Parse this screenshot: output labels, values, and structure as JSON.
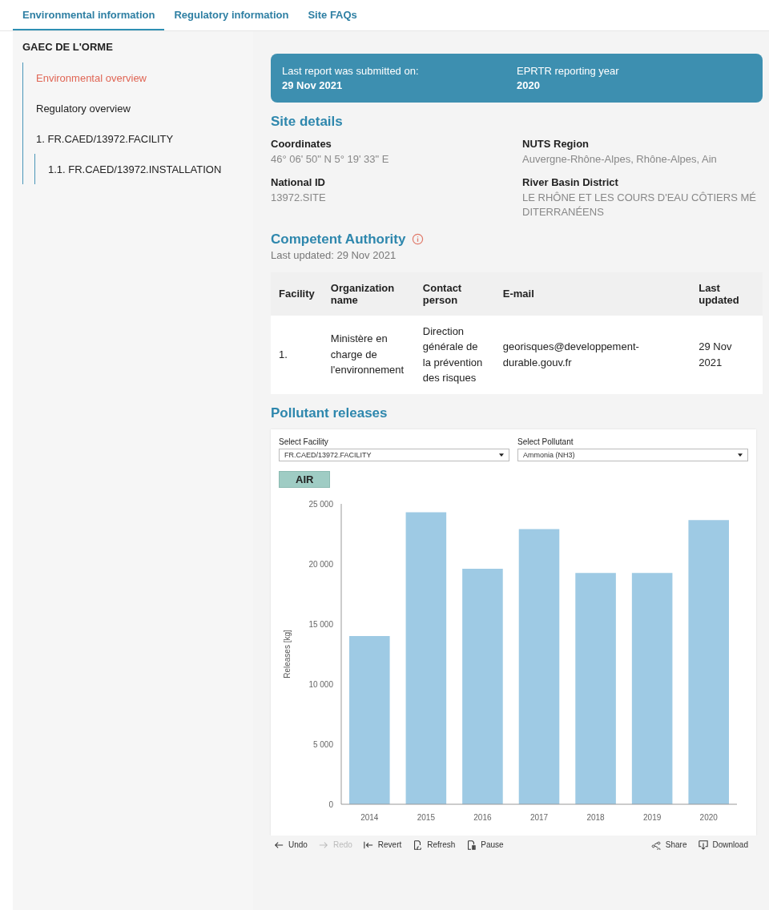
{
  "tabs": [
    {
      "label": "Environmental information",
      "selected": true
    },
    {
      "label": "Regulatory information",
      "selected": false
    },
    {
      "label": "Site FAQs",
      "selected": false
    }
  ],
  "sidebar": {
    "title": "GAEC DE L'ORME",
    "items": [
      {
        "label": "Environmental overview",
        "selected": true
      },
      {
        "label": "Regulatory overview",
        "selected": false
      },
      {
        "label": "1. FR.CAED/13972.FACILITY",
        "selected": false,
        "children": [
          {
            "label": "1.1. FR.CAED/13972.INSTALLATION",
            "selected": false
          }
        ]
      }
    ]
  },
  "banner": [
    {
      "label": "Last report was submitted on:",
      "value": "29 Nov 2021"
    },
    {
      "label": "EPRTR reporting year",
      "value": "2020"
    }
  ],
  "site_details": {
    "title": "Site details",
    "fields": [
      {
        "label": "Coordinates",
        "value": "46° 06' 50\" N 5° 19' 33\" E"
      },
      {
        "label": "NUTS Region",
        "value": "Auvergne-Rhône-Alpes, Rhône-Alpes, Ain"
      },
      {
        "label": "National ID",
        "value": "13972.SITE"
      },
      {
        "label": "River Basin District",
        "value": "LE RHÔNE ET LES COURS D'EAU CÔTIERS MÉDITERRANÉENS"
      }
    ]
  },
  "competent_authority": {
    "title": "Competent Authority",
    "updated": "Last updated: 29 Nov 2021",
    "columns": [
      "Facility",
      "Organization name",
      "Contact person",
      "E-mail",
      "Last updated"
    ],
    "rows": [
      [
        "1.",
        "Ministère en charge de l'environnement",
        "Direction générale de la prévention des risques",
        "georisques@developpement-durable.gouv.fr",
        "29 Nov 2021"
      ]
    ]
  },
  "pollutant_releases": {
    "title": "Pollutant releases",
    "filters": [
      {
        "label": "Select Facility",
        "value": "FR.CAED/13972.FACILITY"
      },
      {
        "label": "Select Pollutant",
        "value": "Ammonia (NH3)"
      }
    ],
    "chart_data": {
      "type": "bar",
      "title": "AIR",
      "ylabel": "Releases [kg]",
      "categories": [
        "2014",
        "2015",
        "2016",
        "2017",
        "2018",
        "2019",
        "2020"
      ],
      "values": [
        14000,
        24300,
        19600,
        22900,
        19250,
        19250,
        23650
      ],
      "ylim": [
        0,
        25000
      ],
      "yticks": [
        {
          "value": 0,
          "label": "0"
        },
        {
          "value": 5000,
          "label": "5 000"
        },
        {
          "value": 10000,
          "label": "10 000"
        },
        {
          "value": 15000,
          "label": "15 000"
        },
        {
          "value": 20000,
          "label": "20 000"
        },
        {
          "value": 25000,
          "label": "25 000"
        }
      ]
    },
    "toolbar": [
      {
        "label": "Undo",
        "disabled": false
      },
      {
        "label": "Redo",
        "disabled": true
      },
      {
        "label": "Revert",
        "disabled": false
      },
      {
        "label": "Refresh",
        "disabled": false
      },
      {
        "label": "Pause",
        "disabled": false
      },
      {
        "label": "Share",
        "disabled": false
      },
      {
        "label": "Download",
        "disabled": false
      }
    ]
  }
}
